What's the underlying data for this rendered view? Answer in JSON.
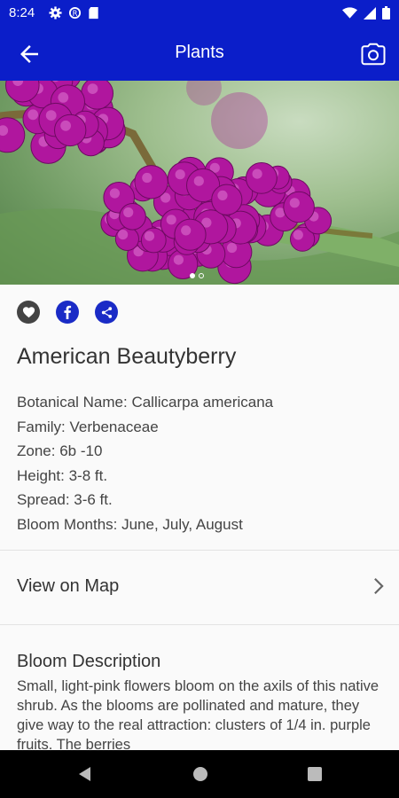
{
  "status_bar": {
    "time": "8:24"
  },
  "app_bar": {
    "title": "Plants"
  },
  "gallery": {
    "page_count": 2,
    "current_page": 1
  },
  "plant": {
    "name": "American Beautyberry",
    "details": [
      "Botanical Name: Callicarpa americana",
      "Family: Verbenaceae",
      "Zone: 6b -10",
      "Height: 3-8 ft.",
      "Spread: 3-6 ft.",
      "Bloom Months: June, July, August"
    ]
  },
  "map_row": {
    "label": "View on Map"
  },
  "bloom": {
    "title": "Bloom Description",
    "text": "Small, light-pink flowers bloom on the axils of this native shrub. As the blooms are pollinated and mature, they give way to the real attraction: clusters of 1/4 in. purple fruits. The berries"
  },
  "colors": {
    "primary": "#0b1ec9",
    "berry": "#b0169e",
    "action_blue": "#1a2bc6"
  },
  "icons": [
    "settings-icon",
    "sync-icon",
    "sd-card-icon",
    "wifi-icon",
    "cell-signal-icon",
    "battery-icon",
    "back-arrow-icon",
    "camera-icon",
    "heart-icon",
    "facebook-icon",
    "share-icon",
    "chevron-right-icon"
  ]
}
